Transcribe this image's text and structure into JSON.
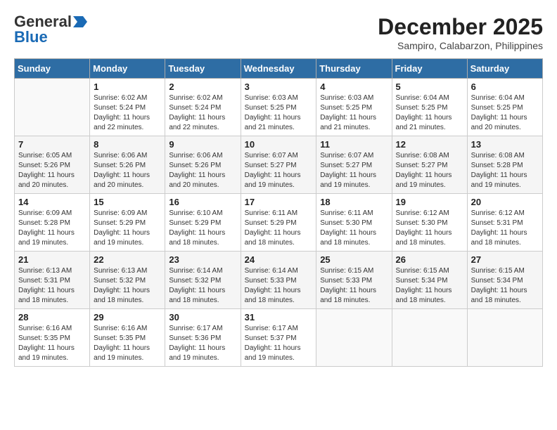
{
  "header": {
    "logo_general": "General",
    "logo_blue": "Blue",
    "month_title": "December 2025",
    "location": "Sampiro, Calabarzon, Philippines"
  },
  "days_of_week": [
    "Sunday",
    "Monday",
    "Tuesday",
    "Wednesday",
    "Thursday",
    "Friday",
    "Saturday"
  ],
  "weeks": [
    [
      {
        "day": "",
        "sunrise": "",
        "sunset": "",
        "daylight": ""
      },
      {
        "day": "1",
        "sunrise": "Sunrise: 6:02 AM",
        "sunset": "Sunset: 5:24 PM",
        "daylight": "Daylight: 11 hours and 22 minutes."
      },
      {
        "day": "2",
        "sunrise": "Sunrise: 6:02 AM",
        "sunset": "Sunset: 5:24 PM",
        "daylight": "Daylight: 11 hours and 22 minutes."
      },
      {
        "day": "3",
        "sunrise": "Sunrise: 6:03 AM",
        "sunset": "Sunset: 5:25 PM",
        "daylight": "Daylight: 11 hours and 21 minutes."
      },
      {
        "day": "4",
        "sunrise": "Sunrise: 6:03 AM",
        "sunset": "Sunset: 5:25 PM",
        "daylight": "Daylight: 11 hours and 21 minutes."
      },
      {
        "day": "5",
        "sunrise": "Sunrise: 6:04 AM",
        "sunset": "Sunset: 5:25 PM",
        "daylight": "Daylight: 11 hours and 21 minutes."
      },
      {
        "day": "6",
        "sunrise": "Sunrise: 6:04 AM",
        "sunset": "Sunset: 5:25 PM",
        "daylight": "Daylight: 11 hours and 20 minutes."
      }
    ],
    [
      {
        "day": "7",
        "sunrise": "Sunrise: 6:05 AM",
        "sunset": "Sunset: 5:26 PM",
        "daylight": "Daylight: 11 hours and 20 minutes."
      },
      {
        "day": "8",
        "sunrise": "Sunrise: 6:06 AM",
        "sunset": "Sunset: 5:26 PM",
        "daylight": "Daylight: 11 hours and 20 minutes."
      },
      {
        "day": "9",
        "sunrise": "Sunrise: 6:06 AM",
        "sunset": "Sunset: 5:26 PM",
        "daylight": "Daylight: 11 hours and 20 minutes."
      },
      {
        "day": "10",
        "sunrise": "Sunrise: 6:07 AM",
        "sunset": "Sunset: 5:27 PM",
        "daylight": "Daylight: 11 hours and 19 minutes."
      },
      {
        "day": "11",
        "sunrise": "Sunrise: 6:07 AM",
        "sunset": "Sunset: 5:27 PM",
        "daylight": "Daylight: 11 hours and 19 minutes."
      },
      {
        "day": "12",
        "sunrise": "Sunrise: 6:08 AM",
        "sunset": "Sunset: 5:27 PM",
        "daylight": "Daylight: 11 hours and 19 minutes."
      },
      {
        "day": "13",
        "sunrise": "Sunrise: 6:08 AM",
        "sunset": "Sunset: 5:28 PM",
        "daylight": "Daylight: 11 hours and 19 minutes."
      }
    ],
    [
      {
        "day": "14",
        "sunrise": "Sunrise: 6:09 AM",
        "sunset": "Sunset: 5:28 PM",
        "daylight": "Daylight: 11 hours and 19 minutes."
      },
      {
        "day": "15",
        "sunrise": "Sunrise: 6:09 AM",
        "sunset": "Sunset: 5:29 PM",
        "daylight": "Daylight: 11 hours and 19 minutes."
      },
      {
        "day": "16",
        "sunrise": "Sunrise: 6:10 AM",
        "sunset": "Sunset: 5:29 PM",
        "daylight": "Daylight: 11 hours and 18 minutes."
      },
      {
        "day": "17",
        "sunrise": "Sunrise: 6:11 AM",
        "sunset": "Sunset: 5:29 PM",
        "daylight": "Daylight: 11 hours and 18 minutes."
      },
      {
        "day": "18",
        "sunrise": "Sunrise: 6:11 AM",
        "sunset": "Sunset: 5:30 PM",
        "daylight": "Daylight: 11 hours and 18 minutes."
      },
      {
        "day": "19",
        "sunrise": "Sunrise: 6:12 AM",
        "sunset": "Sunset: 5:30 PM",
        "daylight": "Daylight: 11 hours and 18 minutes."
      },
      {
        "day": "20",
        "sunrise": "Sunrise: 6:12 AM",
        "sunset": "Sunset: 5:31 PM",
        "daylight": "Daylight: 11 hours and 18 minutes."
      }
    ],
    [
      {
        "day": "21",
        "sunrise": "Sunrise: 6:13 AM",
        "sunset": "Sunset: 5:31 PM",
        "daylight": "Daylight: 11 hours and 18 minutes."
      },
      {
        "day": "22",
        "sunrise": "Sunrise: 6:13 AM",
        "sunset": "Sunset: 5:32 PM",
        "daylight": "Daylight: 11 hours and 18 minutes."
      },
      {
        "day": "23",
        "sunrise": "Sunrise: 6:14 AM",
        "sunset": "Sunset: 5:32 PM",
        "daylight": "Daylight: 11 hours and 18 minutes."
      },
      {
        "day": "24",
        "sunrise": "Sunrise: 6:14 AM",
        "sunset": "Sunset: 5:33 PM",
        "daylight": "Daylight: 11 hours and 18 minutes."
      },
      {
        "day": "25",
        "sunrise": "Sunrise: 6:15 AM",
        "sunset": "Sunset: 5:33 PM",
        "daylight": "Daylight: 11 hours and 18 minutes."
      },
      {
        "day": "26",
        "sunrise": "Sunrise: 6:15 AM",
        "sunset": "Sunset: 5:34 PM",
        "daylight": "Daylight: 11 hours and 18 minutes."
      },
      {
        "day": "27",
        "sunrise": "Sunrise: 6:15 AM",
        "sunset": "Sunset: 5:34 PM",
        "daylight": "Daylight: 11 hours and 18 minutes."
      }
    ],
    [
      {
        "day": "28",
        "sunrise": "Sunrise: 6:16 AM",
        "sunset": "Sunset: 5:35 PM",
        "daylight": "Daylight: 11 hours and 19 minutes."
      },
      {
        "day": "29",
        "sunrise": "Sunrise: 6:16 AM",
        "sunset": "Sunset: 5:35 PM",
        "daylight": "Daylight: 11 hours and 19 minutes."
      },
      {
        "day": "30",
        "sunrise": "Sunrise: 6:17 AM",
        "sunset": "Sunset: 5:36 PM",
        "daylight": "Daylight: 11 hours and 19 minutes."
      },
      {
        "day": "31",
        "sunrise": "Sunrise: 6:17 AM",
        "sunset": "Sunset: 5:37 PM",
        "daylight": "Daylight: 11 hours and 19 minutes."
      },
      {
        "day": "",
        "sunrise": "",
        "sunset": "",
        "daylight": ""
      },
      {
        "day": "",
        "sunrise": "",
        "sunset": "",
        "daylight": ""
      },
      {
        "day": "",
        "sunrise": "",
        "sunset": "",
        "daylight": ""
      }
    ]
  ]
}
